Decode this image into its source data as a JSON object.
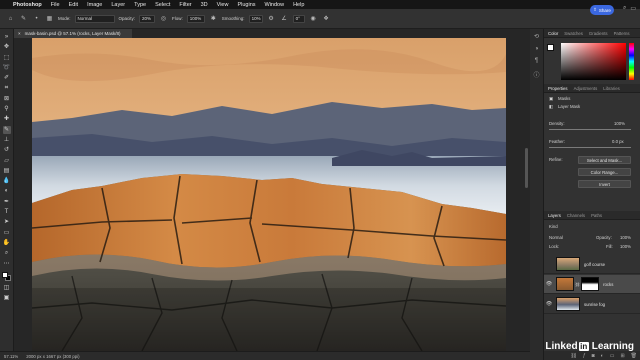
{
  "menubar": {
    "apple": "",
    "items": [
      "Photoshop",
      "File",
      "Edit",
      "Image",
      "Layer",
      "Type",
      "Select",
      "Filter",
      "3D",
      "View",
      "Plugins",
      "Window",
      "Help"
    ]
  },
  "options": {
    "mode_label": "Mode:",
    "mode_value": "Normal",
    "opacity_label": "Opacity:",
    "opacity_value": "20%",
    "flow_label": "Flow:",
    "flow_value": "100%",
    "smoothing_label": "Smoothing:",
    "smoothing_value": "10%",
    "angle_value": "0°",
    "share_label": "Share"
  },
  "document": {
    "tab_title": "mask-basin.psd @ 57.1% (rocks, Layer Mask/8)",
    "close": "×"
  },
  "status": {
    "zoom": "57.11%",
    "size": "2000 px x 1667 px (300 ppi)"
  },
  "color_panel": {
    "tabs": [
      "Color",
      "Swatches",
      "Gradients",
      "Patterns"
    ]
  },
  "properties_panel": {
    "tabs": [
      "Properties",
      "Adjustments",
      "Libraries"
    ],
    "section": "Masks",
    "mask_type": "Layer Mask",
    "density_label": "Density:",
    "density_value": "100%",
    "feather_label": "Feather:",
    "feather_value": "0.0 px",
    "refine_label": "Refine:",
    "select_mask": "Select and Mask...",
    "color_range": "Color Range...",
    "invert": "Invert"
  },
  "layers_panel": {
    "tabs": [
      "Layers",
      "Channels",
      "Paths"
    ],
    "filter_label": "Kind",
    "blend_mode": "Normal",
    "opacity_label": "Opacity:",
    "opacity_value": "100%",
    "fill_label": "Fill:",
    "fill_value": "100%",
    "lock_label": "Lock:",
    "layers": [
      {
        "name": "golf course"
      },
      {
        "name": "rocks"
      },
      {
        "name": "sunrise fog"
      }
    ]
  },
  "watermark": {
    "brand": "Linked",
    "in": "in",
    "rest": "Learning"
  },
  "colors": {
    "accent": "#3b68e0",
    "chrome": "#323232",
    "menubar": "#161616"
  }
}
